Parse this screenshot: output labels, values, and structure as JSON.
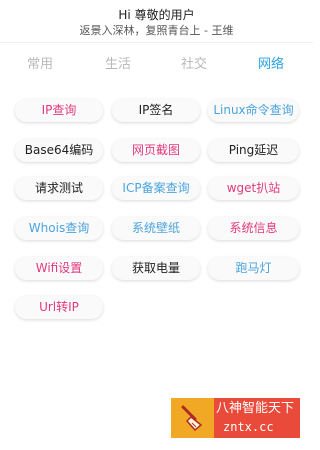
{
  "header": {
    "greeting": "Hi 尊敬的用户",
    "quote": "返景入深林，复照青台上 - 王维"
  },
  "tabs": [
    {
      "label": "常用"
    },
    {
      "label": "生活"
    },
    {
      "label": "社交"
    },
    {
      "label": "网络"
    }
  ],
  "active_tab": "网络",
  "tools": [
    {
      "label": "IP查询",
      "color": "#e23a7e"
    },
    {
      "label": "IP签名",
      "color": "#222222"
    },
    {
      "label": "Linux命令查询",
      "color": "#4aa3dd"
    },
    {
      "label": "Base64编码",
      "color": "#222222"
    },
    {
      "label": "网页截图",
      "color": "#e23a7e"
    },
    {
      "label": "Ping延迟",
      "color": "#222222"
    },
    {
      "label": "请求测试",
      "color": "#222222"
    },
    {
      "label": "ICP备案查询",
      "color": "#4aa3dd"
    },
    {
      "label": "wget扒站",
      "color": "#e23a7e"
    },
    {
      "label": "Whois查询",
      "color": "#4aa3dd"
    },
    {
      "label": "系统壁纸",
      "color": "#4aa3dd"
    },
    {
      "label": "系统信息",
      "color": "#e23a7e"
    },
    {
      "label": "Wifi设置",
      "color": "#e23a7e"
    },
    {
      "label": "获取电量",
      "color": "#222222"
    },
    {
      "label": "跑马灯",
      "color": "#4aa3dd"
    },
    {
      "label": "Url转IP",
      "color": "#e23a7e"
    }
  ],
  "watermark": {
    "title": "八神智能天下",
    "site": "zntx.cc",
    "icon": "broom-icon"
  }
}
